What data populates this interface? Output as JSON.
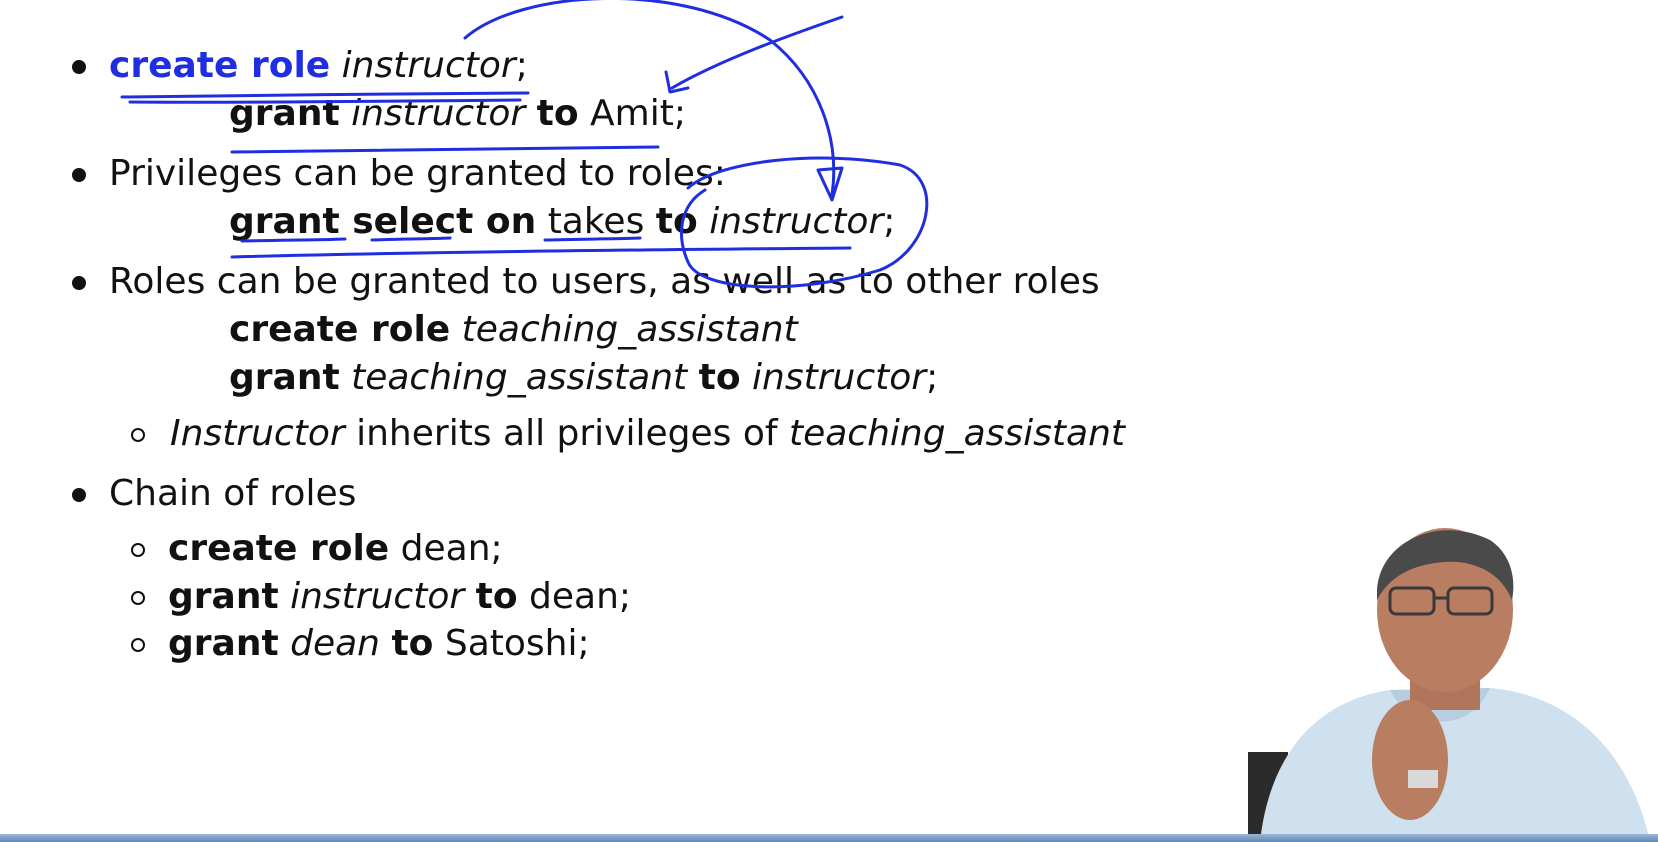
{
  "slide": {
    "b1": {
      "kw1": "create role",
      "arg": "instructor",
      "semi": ";"
    },
    "b1_sub": {
      "kw1": "grant",
      "arg": "instructor",
      "kw2": "to",
      "user": "Amit;"
    },
    "b2": {
      "text": "Privileges can be granted to roles:"
    },
    "b2_sub": {
      "kw1": "grant select on",
      "table": "takes",
      "kw2": "to",
      "arg": "instructor",
      "semi": ";"
    },
    "b3": {
      "text": "Roles can be granted to users, as well as to other roles"
    },
    "b3_sub1": {
      "kw1": "create role",
      "arg": "teaching_assistant"
    },
    "b3_sub2": {
      "kw1": "grant",
      "arg1": "teaching_assistant",
      "kw2": "to",
      "arg2": "instructor",
      "semi": ";"
    },
    "b3_note": {
      "arg1": "Instructor",
      "mid": "inherits all privileges of",
      "arg2": "teaching_assistant"
    },
    "b4": {
      "text": "Chain of roles"
    },
    "b4_items": [
      {
        "kw1": "create role",
        "rest": "dean;"
      },
      {
        "kw1": "grant",
        "arg": "instructor",
        "kw2": "to",
        "rest": "dean;"
      },
      {
        "kw1": "grant",
        "arg": "dean",
        "kw2": "to",
        "rest": "Satoshi;"
      }
    ]
  },
  "colors": {
    "ink": "#1f2ee0",
    "text": "#111111",
    "background": "#ffffff"
  }
}
